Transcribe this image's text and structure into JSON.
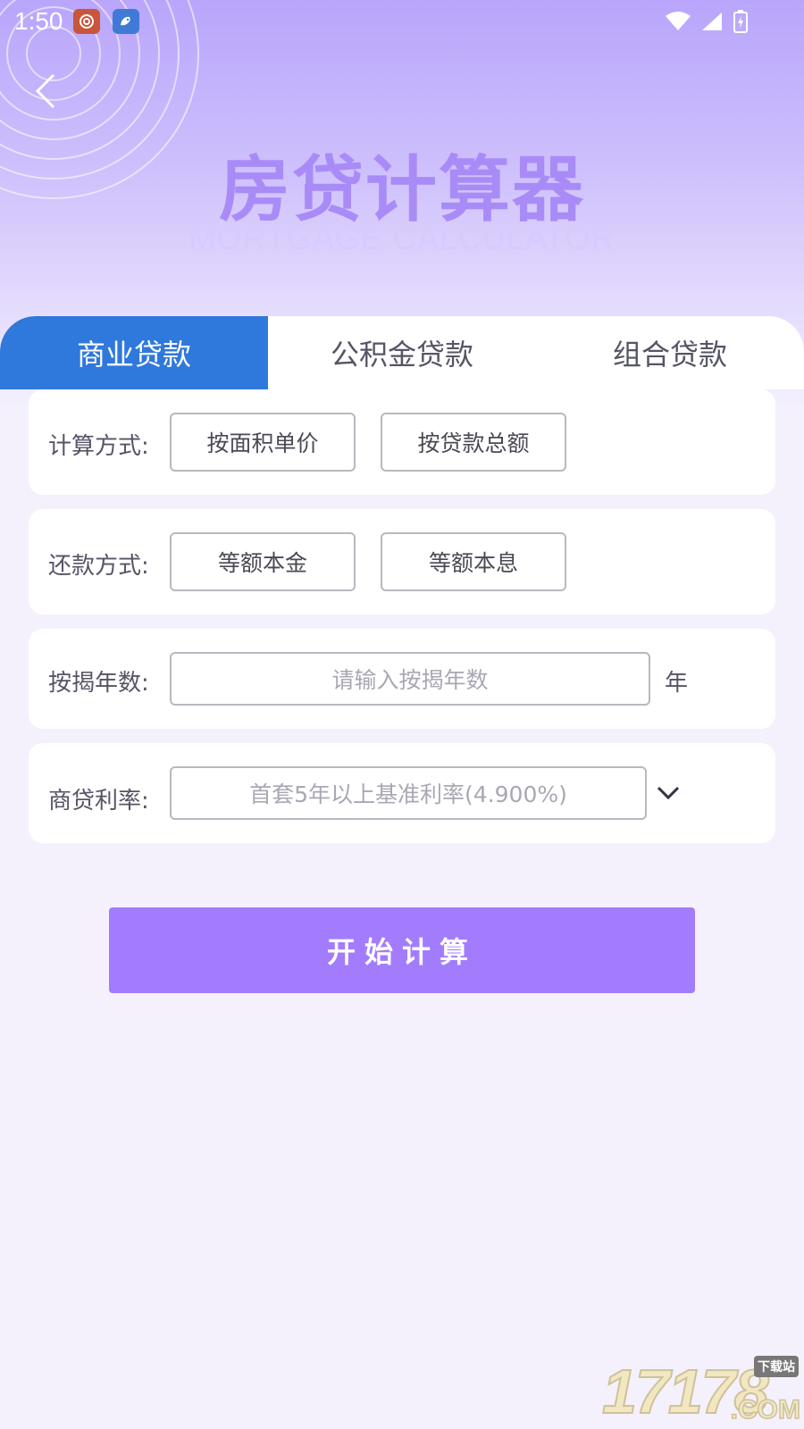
{
  "status_bar": {
    "time": "1:50"
  },
  "header": {
    "title_cn": "房贷计算器",
    "title_en": "MORTGAGE CALCULATOR"
  },
  "tabs": [
    {
      "label": "商业贷款",
      "active": true
    },
    {
      "label": "公积金贷款",
      "active": false
    },
    {
      "label": "组合贷款",
      "active": false
    }
  ],
  "calc_method": {
    "label": "计算方式:",
    "options": [
      "按面积单价",
      "按贷款总额"
    ]
  },
  "repay_method": {
    "label": "还款方式:",
    "options": [
      "等额本金",
      "等额本息"
    ]
  },
  "loan_years": {
    "label": "按揭年数:",
    "placeholder": "请输入按揭年数",
    "unit": "年"
  },
  "loan_rate": {
    "label": "商贷利率:",
    "placeholder": "首套5年以上基准利率(4.900%)"
  },
  "submit": {
    "label": "开始计算"
  },
  "watermark": {
    "number": "17178",
    "tag": "下载站",
    "suffix": ".COM"
  },
  "colors": {
    "accent": "#a37cfd",
    "tab_active": "#2f78dc",
    "title": "#a98bf8"
  }
}
